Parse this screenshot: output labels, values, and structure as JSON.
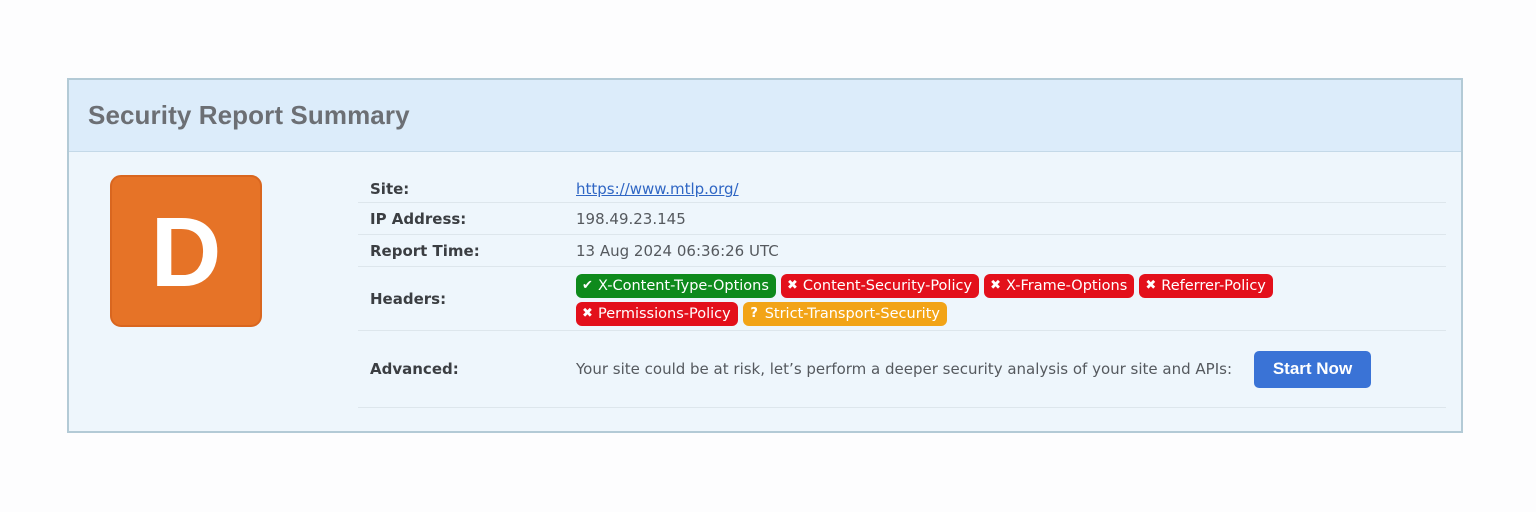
{
  "report": {
    "title": "Security Report Summary",
    "grade": "D",
    "grade_color": "#e67327"
  },
  "rows": {
    "site": {
      "label": "Site:",
      "value": "https://www.mtlp.org/"
    },
    "ip": {
      "label": "IP Address:",
      "value": "198.49.23.145"
    },
    "time": {
      "label": "Report Time:",
      "value": "13 Aug 2024 06:36:26 UTC"
    },
    "headers": {
      "label": "Headers:",
      "items": [
        {
          "name": "X-Content-Type-Options",
          "status": "pass",
          "icon": "check-icon",
          "glyph": "✔",
          "color": "#0e8a1c"
        },
        {
          "name": "Content-Security-Policy",
          "status": "fail",
          "icon": "cross-icon",
          "glyph": "✖",
          "color": "#e3101b"
        },
        {
          "name": "X-Frame-Options",
          "status": "fail",
          "icon": "cross-icon",
          "glyph": "✖",
          "color": "#e3101b"
        },
        {
          "name": "Referrer-Policy",
          "status": "fail",
          "icon": "cross-icon",
          "glyph": "✖",
          "color": "#e3101b"
        },
        {
          "name": "Permissions-Policy",
          "status": "fail",
          "icon": "cross-icon",
          "glyph": "✖",
          "color": "#e3101b"
        },
        {
          "name": "Strict-Transport-Security",
          "status": "warning",
          "icon": "question-icon",
          "glyph": "?",
          "color": "#f2a417"
        }
      ]
    },
    "advanced": {
      "label": "Advanced:",
      "text": "Your site could be at risk, let’s perform a deeper security analysis of your site and APIs:",
      "button_label": "Start Now",
      "button_color": "#3a73d6"
    }
  }
}
